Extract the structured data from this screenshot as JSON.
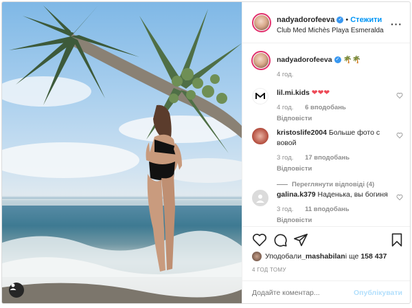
{
  "post": {
    "author": "nadyadorofeeva",
    "follow_label": "Стежити",
    "dot": "•",
    "location": "Club Med Michès Playa Esmeralda",
    "more_label": "···"
  },
  "caption": {
    "author": "nadyadorofeeva",
    "text": "🌴🌴",
    "time": "4 год."
  },
  "comments": [
    {
      "author": "lil.mi.kids",
      "text": "❤❤❤",
      "time": "4 год.",
      "likes": "6 вподобань",
      "reply": "Відповісти"
    },
    {
      "author": "kristoslife2004",
      "text": "Больше фото с вовой",
      "time": "3 год.",
      "likes": "17 вподобань",
      "reply": "Відповісти",
      "view_replies": "Переглянути відповіді (4)"
    },
    {
      "author": "galina.k379",
      "text": "Наденька, вы богиня",
      "time": "3 год.",
      "likes": "11 вподобань",
      "reply": "Відповісти"
    }
  ],
  "likes": {
    "prefix": "Уподобали ",
    "user": "_mashabilan",
    "middle": " і ще ",
    "count": "158 437"
  },
  "timestamp": "4 ГОД ТОМУ",
  "add_comment": {
    "placeholder": "Додайте коментар...",
    "post_label": "Опублікувати"
  },
  "colors": {
    "accent": "#0095f6",
    "verified": "#3897f0",
    "heart": "#ed4956",
    "muted": "#8e8e8e"
  }
}
